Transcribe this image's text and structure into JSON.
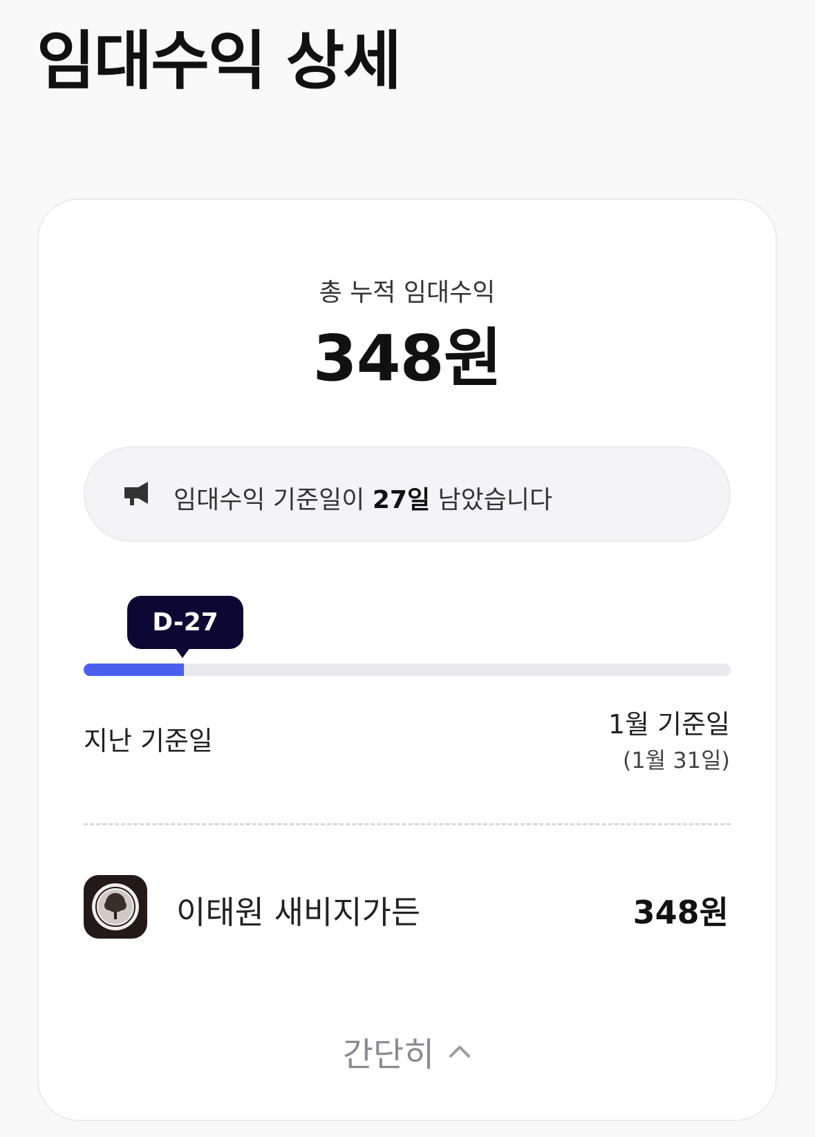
{
  "header": {
    "title": "임대수익 상세"
  },
  "summary": {
    "total_label": "총 누적 임대수익",
    "total_value": "348원"
  },
  "notice": {
    "icon": "megaphone-icon",
    "text_before": "임대수익 기준일이 ",
    "days": "27일",
    "text_after": " 남았습니다"
  },
  "progress": {
    "badge": "D-27",
    "fill_fraction": 0.155,
    "fill_color": "#4a5fef",
    "prev_label": "지난 기준일",
    "next_label": "1월 기준일",
    "next_date": "(1월 31일)"
  },
  "assets": [
    {
      "icon": "tree-seal-logo",
      "name": "이태원 새비지가든",
      "amount": "348원"
    }
  ],
  "footer": {
    "collapse_label": "간단히",
    "collapse_icon": "chevron-up-icon"
  }
}
